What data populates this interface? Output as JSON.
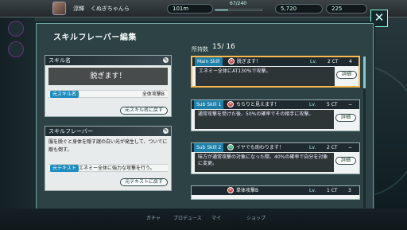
{
  "topbar": {
    "player_name": "淳輝",
    "rank_text": "くぬぎちゃんら",
    "level_label": "101m",
    "exp_text": "67/240",
    "currency_1": "5,720",
    "currency_2": "225",
    "progress": 0.28
  },
  "panel": {
    "title": "スキルフレーバー編集",
    "close_label": "✕"
  },
  "skill_name_card": {
    "header": "スキル名",
    "value": "脱ぎます！",
    "original_tag": "元スキル名",
    "original_value": "全体攻撃B",
    "reset_button": "元スキル名に戻す"
  },
  "flavor_card": {
    "header": "スキルフレーバー",
    "text_line_1": "服を脱ぐと身体を隠す謎の白い光が発生して、ついでに",
    "text_line_2": "敵も倒す。",
    "original_tag": "元テキスト",
    "original_text": "エネミー全体に強力な攻撃を行う。",
    "reset_button": "元テキストに戻す"
  },
  "list": {
    "owned_label": "所持数",
    "owned_count": "15/ 16",
    "items": [
      {
        "slot": "Main Skill",
        "name": "脱ぎます！",
        "lv": "Lv.",
        "ct_label": "2 CT",
        "ct_value": "4",
        "desc": "エネミー全体にAT130%で攻撃。",
        "detail": "詳細"
      },
      {
        "slot": "Sub Skill 1",
        "name": "ちらりと見えます！",
        "lv": "Lv.",
        "ct_label": "5 CT",
        "ct_value": "−",
        "desc": "通常攻撃を受けた後、50%の確率でその相手に攻撃。",
        "detail": "詳細"
      },
      {
        "slot": "Sub Skill 2",
        "name": "イヤでも助わります！",
        "lv": "Lv.",
        "ct_label": "2 CT",
        "ct_value": "−",
        "desc": "味方が通常攻撃の対象になった際、40%の確率で自分を対象に変更。",
        "detail": "詳細"
      },
      {
        "slot": "",
        "name": "単体攻撃B",
        "lv": "Lv.",
        "ct_label": "1 CT",
        "ct_value": "3",
        "desc": "",
        "detail": ""
      }
    ]
  },
  "bottom": {
    "tabs": [
      "ガチャ",
      "プロデュース",
      "マイ",
      "ショップ"
    ]
  },
  "colors": {
    "accent": "#7fd5d2",
    "selection": "#ffb84d",
    "tag_blue": "#1e8cbe"
  }
}
